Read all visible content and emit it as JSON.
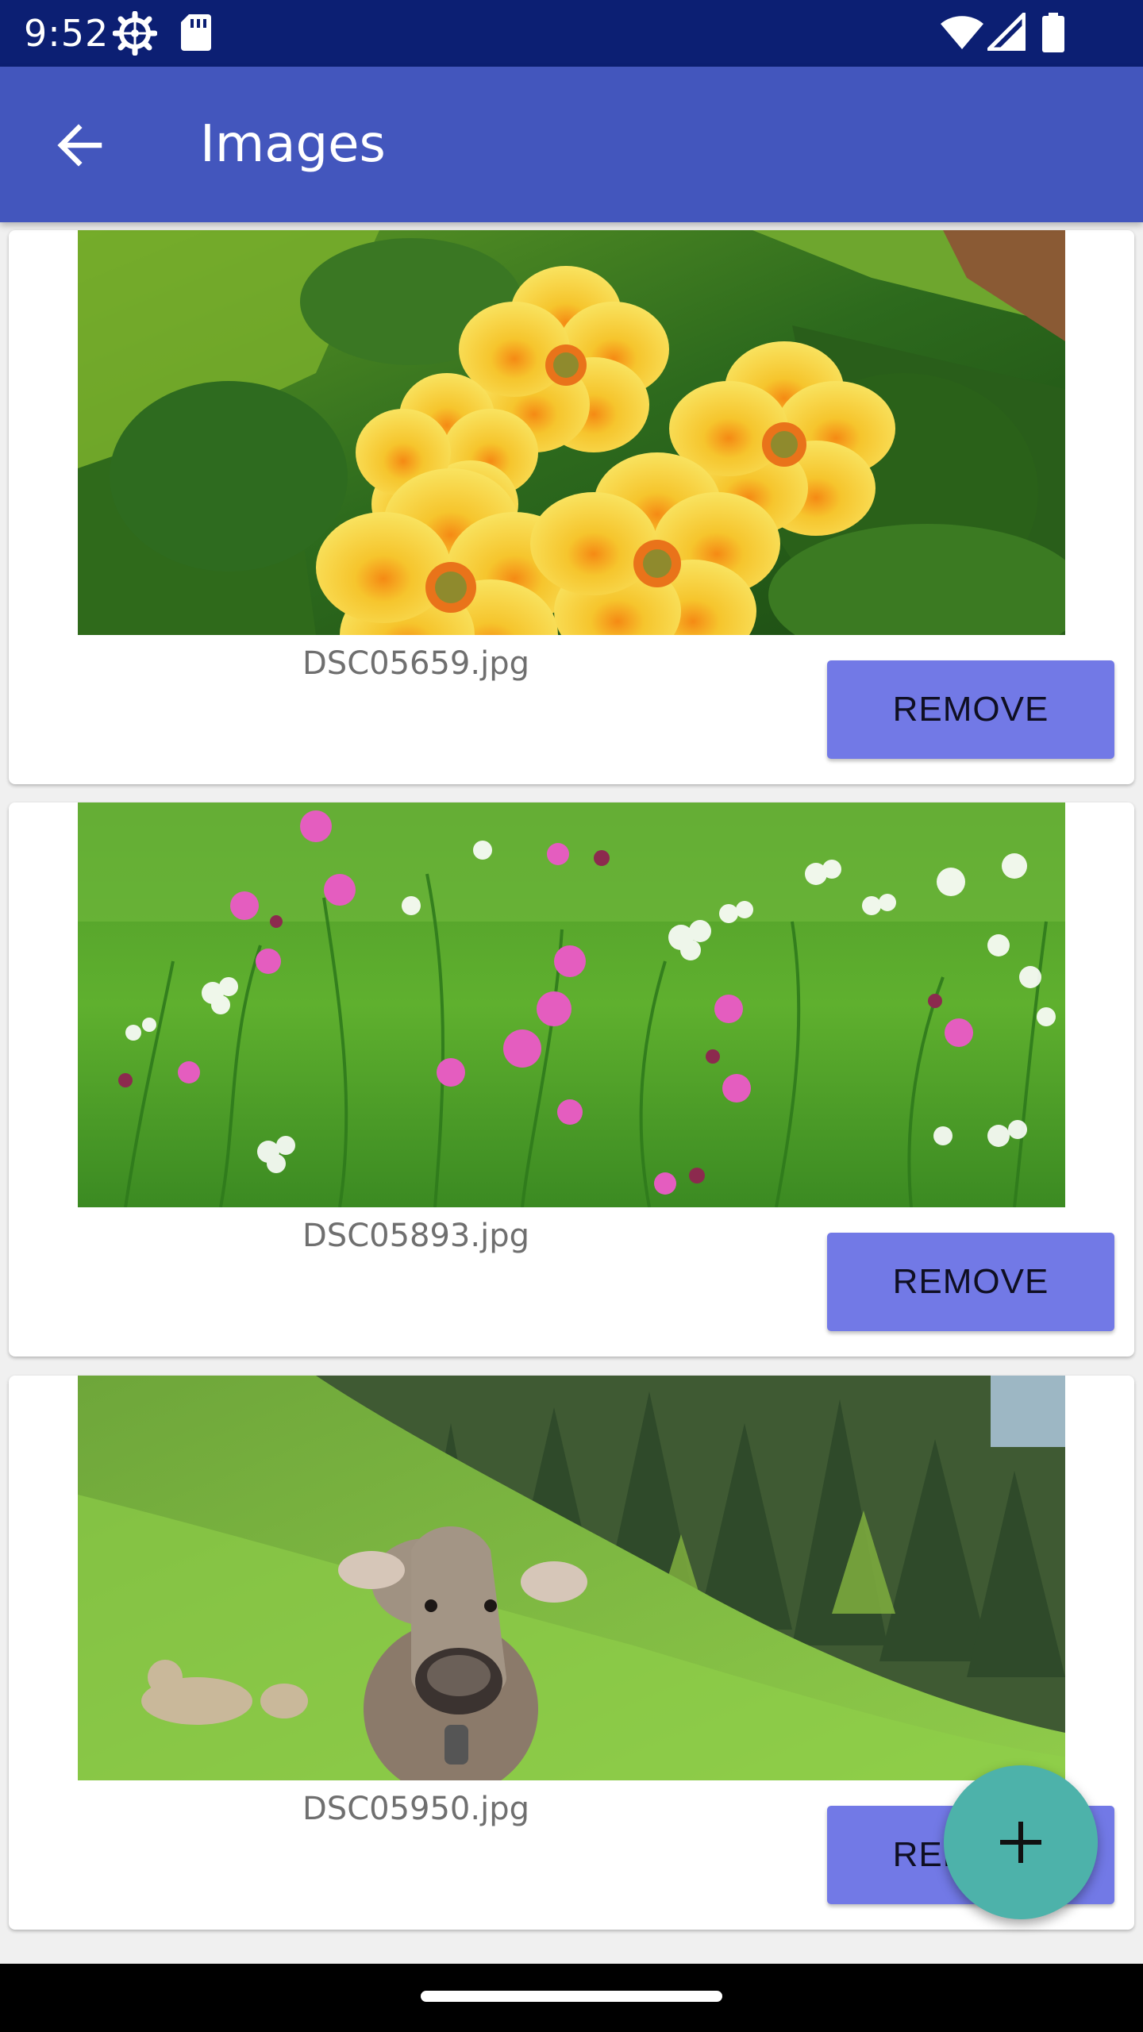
{
  "status_bar": {
    "time": "9:52",
    "icons": [
      "settings-icon",
      "sd-card-icon",
      "wifi-icon",
      "cell-signal-icon",
      "battery-icon"
    ]
  },
  "app_bar": {
    "title": "Images",
    "back_icon": "arrow-back-icon"
  },
  "images": [
    {
      "file_name": "DSC05659.jpg",
      "remove_label": "REMOVE",
      "subject": "yellow-primrose-flowers"
    },
    {
      "file_name": "DSC05893.jpg",
      "remove_label": "REMOVE",
      "subject": "pink-wildflowers-meadow"
    },
    {
      "file_name": "DSC05950.jpg",
      "remove_label": "REMOVE",
      "subject": "cow-on-hillside"
    }
  ],
  "fab": {
    "icon": "plus-icon"
  },
  "colors": {
    "status_bar": "#0c1f73",
    "app_bar": "#4356bd",
    "button": "#7279e6",
    "fab": "#4db2aa"
  }
}
